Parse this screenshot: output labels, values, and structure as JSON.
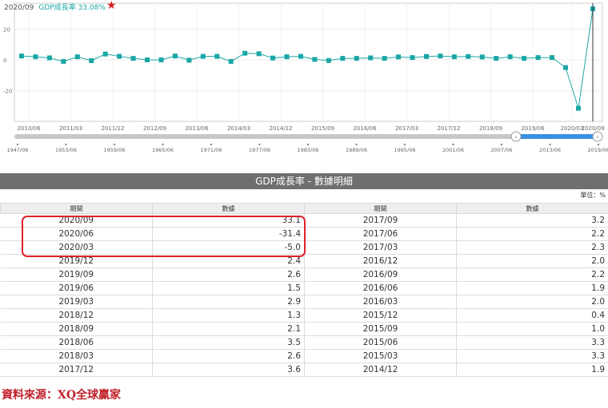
{
  "header": {
    "period": "2020/09",
    "gdp_label": "GDP成長率 33.08%",
    "star_icon": "red-star-icon"
  },
  "chart_data": {
    "type": "line",
    "y_ticks": [
      "20",
      "0",
      "-20"
    ],
    "ylim": [
      -35,
      40
    ],
    "x_tick_labels": [
      "2010/06",
      "2011/03",
      "2011/12",
      "2012/09",
      "2013/06",
      "2014/03",
      "2014/12",
      "2015/09",
      "2016/06",
      "2017/03",
      "2017/12",
      "2018/09",
      "2019/06",
      "2020/03",
      "2020/09"
    ],
    "series": [
      {
        "values": [
          2.5,
          2.0,
          1.3,
          -1.0,
          2.0,
          -0.5,
          3.8,
          2.3,
          1.0,
          0.0,
          0.0,
          2.5,
          -0.2,
          2.3,
          2.3,
          -1.0,
          4.3,
          4.0,
          1.2,
          2.0,
          2.3,
          0.3,
          -0.4,
          1.0,
          1.0,
          1.3,
          1.0,
          1.9,
          1.5,
          2.2,
          2.5,
          2.0,
          2.2,
          1.9,
          1.0,
          2.0,
          1.0,
          1.5,
          1.5,
          -5.0,
          -31.4,
          33.1
        ]
      }
    ],
    "color": "#1aa6a6",
    "navigator_labels": [
      "1947/06",
      "1953/06",
      "1959/06",
      "1965/06",
      "1971/06",
      "1977/06",
      "1983/06",
      "1989/06",
      "1995/06",
      "2001/06",
      "2007/06",
      "2013/06",
      "2019/06"
    ],
    "grid": true
  },
  "section_title": "GDP成長率 - 數據明細",
  "unit": "單位：%",
  "table": {
    "headers": [
      "期間",
      "數據",
      "期間",
      "數據"
    ],
    "rows": [
      [
        "2020/09",
        "33.1",
        "2017/09",
        "3.2"
      ],
      [
        "2020/06",
        "-31.4",
        "2017/06",
        "2.2"
      ],
      [
        "2020/03",
        "-5.0",
        "2017/03",
        "2.3"
      ],
      [
        "2019/12",
        "2.4",
        "2016/12",
        "2.0"
      ],
      [
        "2019/09",
        "2.6",
        "2016/09",
        "2.2"
      ],
      [
        "2019/06",
        "1.5",
        "2016/06",
        "1.9"
      ],
      [
        "2019/03",
        "2.9",
        "2016/03",
        "2.0"
      ],
      [
        "2018/12",
        "1.3",
        "2015/12",
        "0.4"
      ],
      [
        "2018/09",
        "2.1",
        "2015/09",
        "1.0"
      ],
      [
        "2018/06",
        "3.5",
        "2015/06",
        "3.3"
      ],
      [
        "2018/03",
        "2.6",
        "2015/03",
        "3.3"
      ],
      [
        "2017/12",
        "3.6",
        "2014/12",
        "1.9"
      ]
    ]
  },
  "source": "資料來源：XQ全球贏家"
}
